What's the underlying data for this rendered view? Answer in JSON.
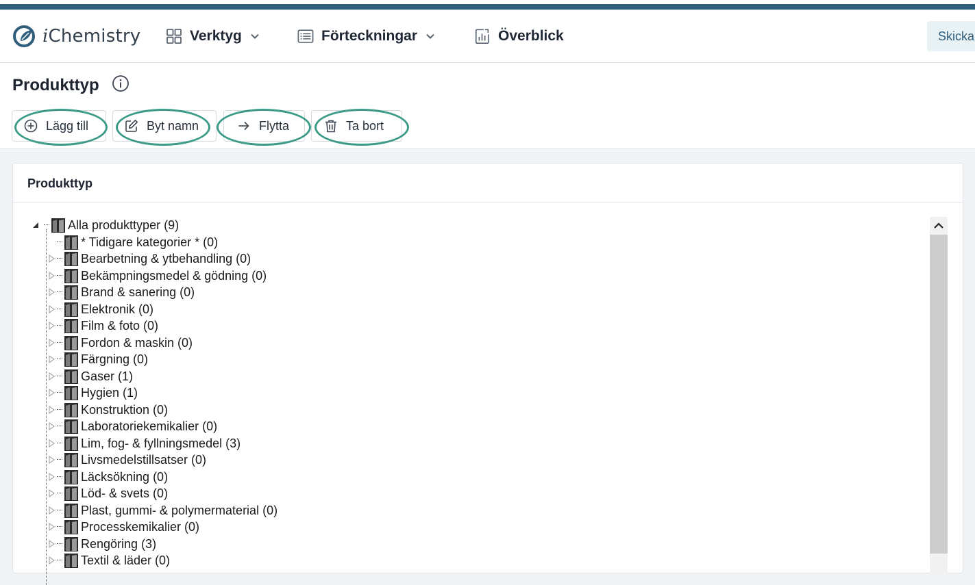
{
  "app": {
    "brand": "iChemistry",
    "brand_prefix": "i",
    "brand_rest": "Chemistry",
    "accent_color": "#2f5d7c",
    "highlight_color": "#3c9b88"
  },
  "nav": {
    "items": [
      {
        "label": "Verktyg",
        "icon": "grid-icon",
        "has_dropdown": true
      },
      {
        "label": "Förteckningar",
        "icon": "list-icon",
        "has_dropdown": true
      },
      {
        "label": "Överblick",
        "icon": "chart-icon",
        "has_dropdown": false
      }
    ],
    "send_label": "Skicka"
  },
  "page": {
    "title": "Produkttyp",
    "info_icon": "info-icon"
  },
  "toolbar": {
    "add_label": "Lägg till",
    "rename_label": "Byt namn",
    "move_label": "Flytta",
    "delete_label": "Ta bort"
  },
  "panel": {
    "title": "Produkttyp"
  },
  "tree": {
    "root": "Alla produkttyper (9)",
    "children": [
      "* Tidigare kategorier * (0)",
      "Bearbetning & ytbehandling (0)",
      "Bekämpningsmedel & gödning (0)",
      "Brand & sanering (0)",
      "Elektronik (0)",
      "Film & foto (0)",
      "Fordon & maskin (0)",
      "Färgning (0)",
      "Gaser (1)",
      "Hygien (1)",
      "Konstruktion (0)",
      "Laboratoriekemikalier (0)",
      "Lim, fog- & fyllningsmedel (3)",
      "Livsmedelstillsatser (0)",
      "Läcksökning (0)",
      "Löd- & svets (0)",
      "Plast, gummi- & polymermaterial (0)",
      "Processkemikalier (0)",
      "Rengöring (3)",
      "Textil & läder (0)"
    ]
  }
}
